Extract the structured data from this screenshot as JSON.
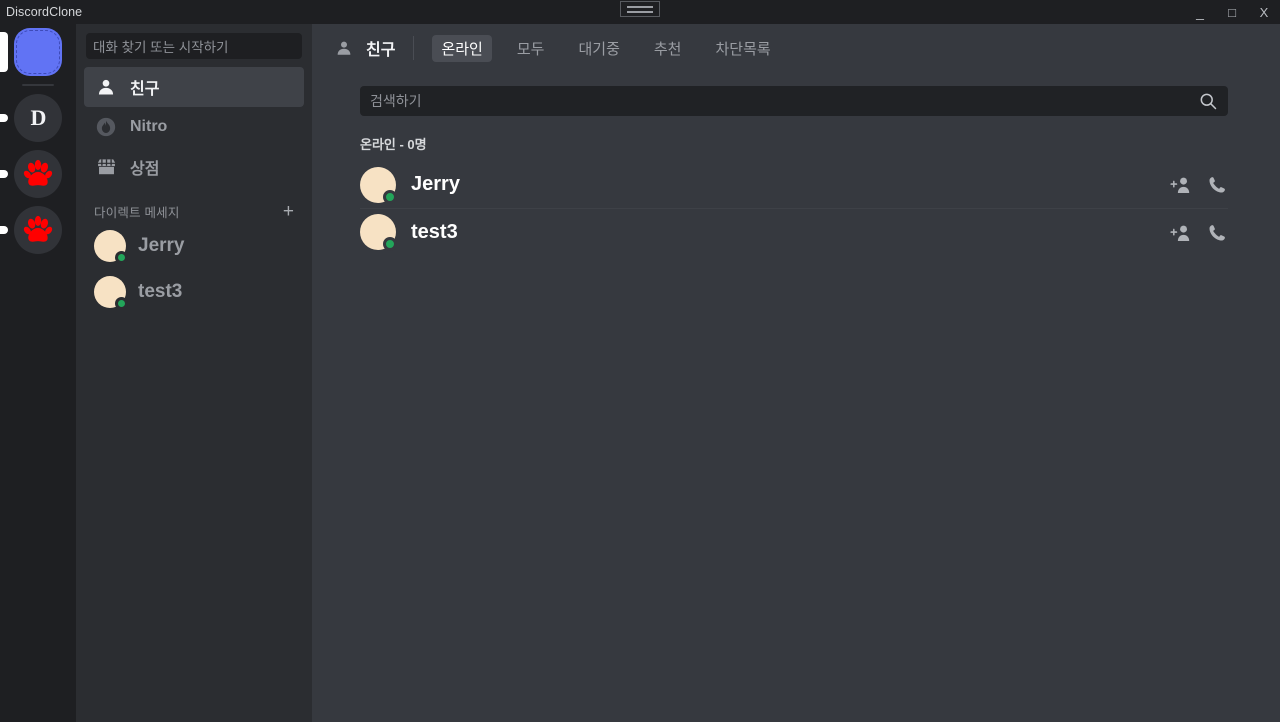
{
  "window": {
    "title": "DiscordClone",
    "controls": {
      "minimize": "_",
      "maximize": "□",
      "close": "X"
    },
    "drag_handle_icon": "drag-handle-icon"
  },
  "rail": {
    "items": [
      {
        "name": "home-button",
        "type": "home",
        "label": "",
        "selected": true,
        "indicator": "pill",
        "color": "#6173f4"
      },
      {
        "name": "server-d",
        "type": "letter",
        "label": "D",
        "selected": false,
        "indicator": "dot",
        "color": "#313338"
      },
      {
        "name": "server-paw-1",
        "type": "paw",
        "label": "",
        "selected": false,
        "indicator": "dot",
        "color": "#ff0000"
      },
      {
        "name": "server-paw-2",
        "type": "paw",
        "label": "",
        "selected": false,
        "indicator": "dot",
        "color": "#ff0000"
      }
    ]
  },
  "sidebar": {
    "search_placeholder": "대화 찾기 또는 시작하기",
    "nav": [
      {
        "icon": "person-icon",
        "label": "친구",
        "active": true
      },
      {
        "icon": "nitro-flame-icon",
        "label": "Nitro",
        "active": false
      },
      {
        "icon": "shop-icon",
        "label": "상점",
        "active": false
      }
    ],
    "dm_section": {
      "title": "다이렉트 메세지",
      "add_label": "+"
    },
    "dms": [
      {
        "name": "Jerry",
        "status": "online"
      },
      {
        "name": "test3",
        "status": "online"
      }
    ]
  },
  "main": {
    "header": {
      "icon": "friends-person-icon",
      "title": "친구"
    },
    "tabs": [
      {
        "label": "온라인",
        "active": true
      },
      {
        "label": "모두",
        "active": false
      },
      {
        "label": "대기중",
        "active": false
      },
      {
        "label": "추천",
        "active": false
      },
      {
        "label": "차단목록",
        "active": false
      }
    ],
    "search": {
      "placeholder": "검색하기",
      "value": "",
      "icon": "search-icon"
    },
    "section_title": "온라인 - 0명",
    "friends": [
      {
        "name": "Jerry",
        "status": "online",
        "actions": [
          "add-person-icon",
          "phone-call-icon"
        ]
      },
      {
        "name": "test3",
        "status": "online",
        "actions": [
          "add-person-icon",
          "phone-call-icon"
        ]
      }
    ]
  },
  "colors": {
    "rail_bg": "#1e1f22",
    "sidebar_bg": "#2b2d31",
    "main_bg": "#36393f",
    "accent": "#6173f4",
    "online": "#23a55a",
    "avatar": "#f7e2c4",
    "paw": "#ff0000"
  }
}
